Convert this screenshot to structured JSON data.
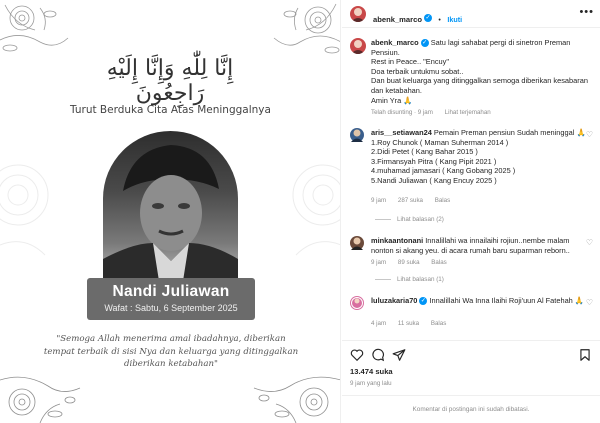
{
  "post": {
    "arabic_text": "إِنَّا لِلّٰهِ وَإِنَّا إِلَيْهِ رَاجِعُونَ",
    "condolence": "Turut Berduka Cita Atas Meninggalnya",
    "name": "Nandi Juliawan",
    "wafat": "Wafat : Sabtu, 6 September 2025",
    "quote": "\"Semoga Allah menerima amal ibadahnya, diberikan tempat terbaik di sisi Nya dan keluarga yang ditinggalkan diberikan ketabahan\""
  },
  "header": {
    "username": "abenk_marco",
    "separator": "•",
    "follow_label": "Ikuti",
    "more_icon": "more-icon"
  },
  "caption": {
    "username": "abenk_marco",
    "lines": [
      "Satu lagi sahabat pergi di sinetron Preman Pensiun.",
      "Rest in Peace.. \"Encuy\"",
      "Doa terbaik untukmu sobat..",
      "Dan buat keluarga yang ditinggalkan semoga diberikan kesabaran dan ketabahan.",
      "Amin Yra 🙏"
    ],
    "edited": "Telah disunting · 9 jam",
    "translate": "Lihat terjemahan"
  },
  "comments": [
    {
      "username": "aris__setiawan24",
      "lines": [
        "Pemain Preman pensiun Sudah meninggal 🙏",
        "1.Roy Chunok ( Maman Suherman 2014 )",
        "2.Didi Petet ( Kang Bahar 2015 )",
        "3.Firmansyah Pitra ( Kang Pipit 2021 )",
        "4.muhamad jamasari ( Kang Gobang 2025 )",
        "5.Nandi Juliawan ( Kang Encuy 2025 )"
      ],
      "time": "9 jam",
      "likes": "287 suka",
      "reply": "Balas",
      "replies": "Lihat balasan (2)"
    },
    {
      "username": "minkaantonani",
      "lines": [
        "Innalillahi wa innailaihi rojiun..nembe malam nonton si akang yeu. di acara rumah baru suparman reborn.."
      ],
      "time": "9 jam",
      "likes": "89 suka",
      "reply": "Balas",
      "replies": "Lihat balasan (1)"
    },
    {
      "username": "luluzakaria70",
      "lines": [
        "Innalillahi Wa Inna Ilaihi Roji'uun Al Fatehah 🙏"
      ],
      "time": "4 jam",
      "likes": "11 suka",
      "reply": "Balas"
    }
  ],
  "stats": {
    "likes": "13.474 suka",
    "ago": "9 jam yang lalu"
  },
  "footer": {
    "comments_limited": "Komentar di postingan ini sudah dibatasi."
  },
  "colors": {
    "accent": "#0095f6",
    "avatar": "#c94848",
    "muted": "#8e8e8e"
  }
}
